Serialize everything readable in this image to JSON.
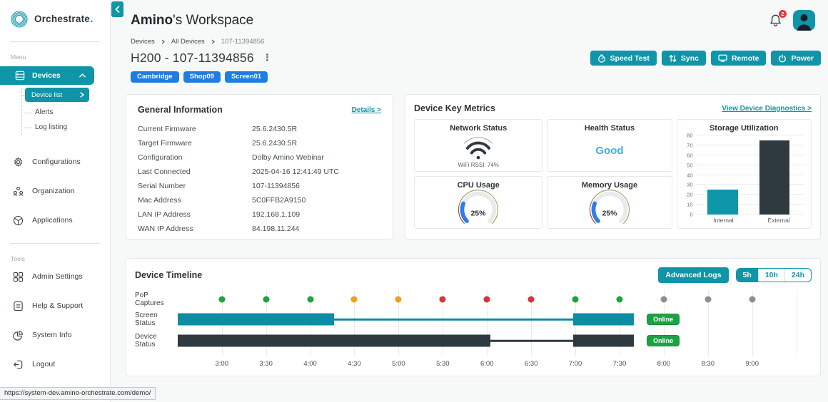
{
  "app": {
    "brand": "Orchestrate",
    "brand_dot": ".",
    "url_tooltip": "https://system-dev.amino-orchestrate.com/demo/"
  },
  "header": {
    "workspace_bold": "Amino",
    "workspace_rest": "'s Workspace",
    "notification_count": "2"
  },
  "breadcrumb": [
    "Devices",
    "All Devices",
    "107-11394856"
  ],
  "device": {
    "title": "H200 - 107-11394856",
    "tags": [
      "Cambridge",
      "Shop09",
      "Screen01"
    ]
  },
  "actions": [
    {
      "label": "Speed Test",
      "icon": "speed-test-icon"
    },
    {
      "label": "Sync",
      "icon": "sync-icon"
    },
    {
      "label": "Remote",
      "icon": "remote-icon"
    },
    {
      "label": "Power",
      "icon": "power-icon"
    }
  ],
  "sidebar": {
    "menu_label": "Menu",
    "tools_label": "Tools",
    "devices": {
      "label": "Devices",
      "children": [
        "Device list",
        "Alerts",
        "Log listing"
      ],
      "active_child": "Device list"
    },
    "menu_items": [
      {
        "label": "Configurations",
        "icon": "gear-icon"
      },
      {
        "label": "Organization",
        "icon": "people-icon"
      },
      {
        "label": "Applications",
        "icon": "package-icon"
      }
    ],
    "tool_items": [
      {
        "label": "Admin Settings",
        "icon": "grid-icon"
      },
      {
        "label": "Help & Support",
        "icon": "document-icon"
      },
      {
        "label": "System Info",
        "icon": "pie-icon"
      },
      {
        "label": "Logout",
        "icon": "logout-icon"
      }
    ]
  },
  "general_info": {
    "title": "General Information",
    "details_link": "Details >",
    "rows": [
      {
        "label": "Current Firmware",
        "value": "25.6.2430.5R"
      },
      {
        "label": "Target Firmware",
        "value": "25.6.2430.5R"
      },
      {
        "label": "Configuration",
        "value": "Dolby Amino Webinar"
      },
      {
        "label": "Last Connected",
        "value": "2025-04-16 12:41:49 UTC"
      },
      {
        "label": "Serial Number",
        "value": "107-11394856"
      },
      {
        "label": "Mac Address",
        "value": "5C0FFB2A9150"
      },
      {
        "label": "LAN IP Address",
        "value": "192.168.1.109"
      },
      {
        "label": "WAN IP Address",
        "value": "84.198.11.244"
      }
    ]
  },
  "metrics": {
    "title": "Device Key Metrics",
    "diagnostics_link": "View Device Diagnostics >",
    "network": {
      "title": "Network Status",
      "rssi_label": "WiFi RSSI: 74%"
    },
    "health": {
      "title": "Health Status",
      "value": "Good",
      "value_color": "#3fb0d8"
    },
    "cpu": {
      "title": "CPU Usage",
      "percent": 25,
      "display": "25%"
    },
    "memory": {
      "title": "Memory Usage",
      "percent": 25,
      "display": "25%"
    },
    "storage": {
      "title": "Storage Utilization",
      "type": "bar",
      "categories": [
        "Internal",
        "External"
      ],
      "values": [
        25,
        75
      ],
      "ymax": 80,
      "ytick_step": 10,
      "colors": [
        "#0f96ab",
        "#2e3a3f"
      ]
    }
  },
  "timeline": {
    "title": "Device Timeline",
    "advanced_logs_label": "Advanced Logs",
    "ranges": [
      "5h",
      "10h",
      "24h"
    ],
    "active_range": "5h",
    "pop_row_label": "PoP Captures",
    "ticks": [
      "3:00",
      "3:30",
      "4:00",
      "4:30",
      "5:00",
      "5:30",
      "6:00",
      "6:30",
      "7:00",
      "7:30",
      "8:00",
      "8:30",
      "9:00"
    ],
    "tick_start_pct": 7.0,
    "tick_step_pct": 7.02,
    "extra_gridline": true,
    "pop_dots": [
      "green",
      "green",
      "green",
      "amber",
      "amber",
      "red",
      "red",
      "red",
      "green",
      "green",
      "gray",
      "gray",
      "gray"
    ],
    "rows": [
      {
        "label": "Screen Status",
        "color": "#0e8ca3",
        "badge": "Online",
        "segments": [
          {
            "type": "thick",
            "start": 0,
            "end": 24.8
          },
          {
            "type": "thin",
            "start": 24.8,
            "end": 62.8
          },
          {
            "type": "thick",
            "start": 62.8,
            "end": 72.4
          }
        ]
      },
      {
        "label": "Device Status",
        "color": "#2e3a3f",
        "badge": "Online",
        "segments": [
          {
            "type": "thick",
            "start": 0,
            "end": 49.7
          },
          {
            "type": "thin",
            "start": 49.7,
            "end": 62.8
          },
          {
            "type": "thick",
            "start": 62.8,
            "end": 72.4
          }
        ]
      }
    ]
  }
}
